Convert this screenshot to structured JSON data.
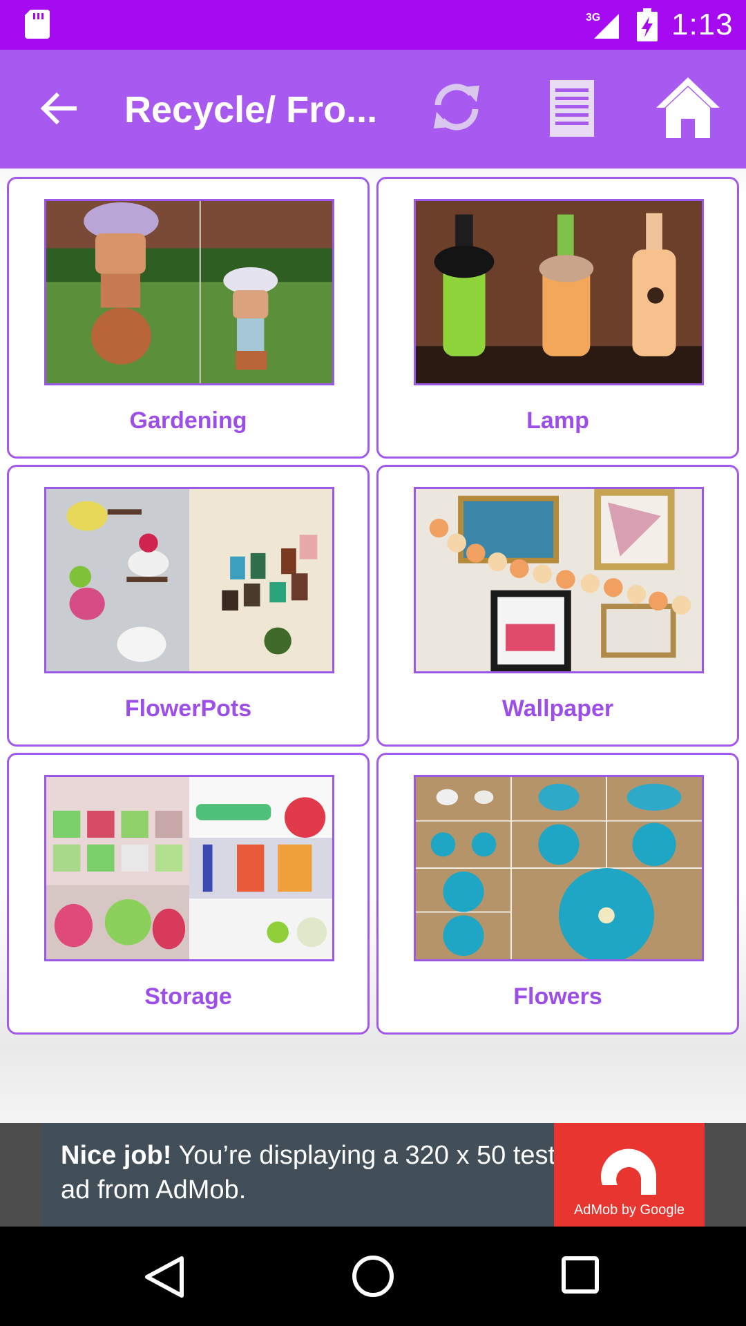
{
  "status_bar": {
    "network": "3G",
    "time": "1:13",
    "icons": [
      "sd-card-icon",
      "signal-icon",
      "battery-charging-icon"
    ]
  },
  "app_bar": {
    "title": "Recycle/ Fro...",
    "icons": [
      "arrow-back-icon",
      "refresh-icon",
      "list-icon",
      "home-icon"
    ],
    "color": "#a759f0"
  },
  "categories": [
    {
      "label": "Gardening",
      "image": "terracotta-pot-figures-photo"
    },
    {
      "label": "Lamp",
      "image": "painted-bottle-lamps-photo"
    },
    {
      "label": "FlowerPots",
      "image": "teapot-and-can-planters-photo"
    },
    {
      "label": "Wallpaper",
      "image": "paper-rose-garland-photo"
    },
    {
      "label": "Storage",
      "image": "recycled-container-collage-photo"
    },
    {
      "label": "Flowers",
      "image": "blue-nylon-flower-steps-photo"
    }
  ],
  "ad": {
    "headline": "Nice job!",
    "body": " You’re displaying a 320 x 50 test ad from AdMob.",
    "logo_caption": "AdMob by Google",
    "logo_color": "#e8352f"
  },
  "nav_bar": {
    "icons": [
      "nav-back-icon",
      "nav-home-icon",
      "nav-recents-icon"
    ]
  },
  "colors": {
    "status_bar": "#a50af0",
    "accent": "#a259ec",
    "label": "#9c4ee8"
  }
}
